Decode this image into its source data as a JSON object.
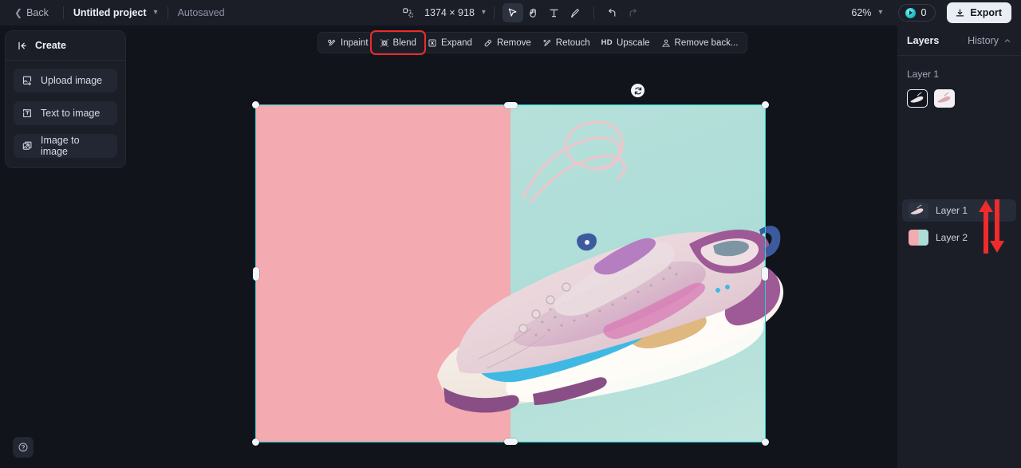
{
  "topbar": {
    "back_label": "Back",
    "project_name": "Untitled project",
    "autosaved_label": "Autosaved",
    "canvas_size_label": "1374 × 918",
    "zoom_label": "62%",
    "credits_count": "0",
    "export_label": "Export",
    "tools": [
      {
        "name": "select-tool",
        "icon": "cursor-icon",
        "active": true
      },
      {
        "name": "hand-tool",
        "icon": "hand-icon",
        "active": false
      },
      {
        "name": "text-tool",
        "icon": "text-icon",
        "active": false
      },
      {
        "name": "brush-tool",
        "icon": "brush-icon",
        "active": false
      },
      {
        "name": "undo",
        "icon": "undo-icon",
        "active": false
      },
      {
        "name": "redo",
        "icon": "redo-icon",
        "active": false
      }
    ]
  },
  "create_panel": {
    "title": "Create",
    "items": [
      {
        "label": "Upload image",
        "icon": "upload-image-icon"
      },
      {
        "label": "Text to image",
        "icon": "text-to-image-icon"
      },
      {
        "label": "Image to image",
        "icon": "image-to-image-icon"
      }
    ]
  },
  "action_bar": {
    "items": [
      {
        "label": "Inpaint",
        "icon": "inpaint-icon",
        "highlighted": false
      },
      {
        "label": "Blend",
        "icon": "blend-icon",
        "highlighted": true
      },
      {
        "label": "Expand",
        "icon": "expand-icon",
        "highlighted": false
      },
      {
        "label": "Remove",
        "icon": "remove-icon",
        "highlighted": false
      },
      {
        "label": "Retouch",
        "icon": "retouch-icon",
        "highlighted": false
      },
      {
        "label": "Upscale",
        "icon": "hd-upscale-icon",
        "highlighted": false
      },
      {
        "label": "Remove back...",
        "icon": "remove-background-icon",
        "highlighted": false
      }
    ],
    "highlight_color": "#ef2b2b"
  },
  "right_panel": {
    "title": "Layers",
    "history_label": "History",
    "active_layer_label": "Layer 1",
    "layers": [
      {
        "label": "Layer 1",
        "thumb": "sneaker-thumb",
        "selected": true
      },
      {
        "label": "Layer 2",
        "thumb": "split-background-thumb",
        "selected": false
      }
    ],
    "annotation_arrows": {
      "up": "reorder-up-arrow",
      "down": "reorder-down-arrow",
      "color": "#ef2b2b"
    }
  },
  "canvas": {
    "artboard_colors": {
      "left": "#f3aab0",
      "right": "#aeddd8"
    },
    "selection_color": "#19d6d2",
    "content_description": "pink and purple sneaker on split pink / mint background"
  },
  "help": {
    "label": "?"
  }
}
